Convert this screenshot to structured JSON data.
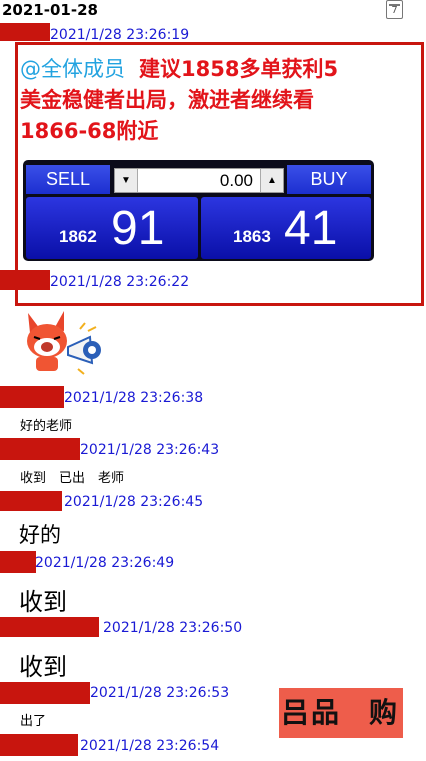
{
  "header": {
    "date": "2021-01-28",
    "calendar_day": "7"
  },
  "announcement": {
    "timestamp": "2021/1/28 23:26:19",
    "mention": "@全体成员",
    "line1": "建议1858多单获利5",
    "line2": "美金稳健者出局，激进者继续看",
    "line3": "1866-68附近"
  },
  "trade_widget": {
    "sell_label": "SELL",
    "buy_label": "BUY",
    "quantity": "0.00",
    "bid_base": "1862",
    "bid_pips": "91",
    "ask_base": "1863",
    "ask_pips": "41"
  },
  "messages": [
    {
      "timestamp": "2021/1/28 23:26:22",
      "text": ""
    },
    {
      "timestamp": "2021/1/28 23:26:38",
      "text": "好的老师"
    },
    {
      "timestamp": "2021/1/28 23:26:43",
      "text": "收到　已出　老师"
    },
    {
      "timestamp": "2021/1/28 23:26:45",
      "text": "好的"
    },
    {
      "timestamp": "2021/1/28 23:26:49",
      "text": "收到"
    },
    {
      "timestamp": "2021/1/28 23:26:50",
      "text": "收到"
    },
    {
      "timestamp": "2021/1/28 23:26:53",
      "text": "出了"
    },
    {
      "timestamp": "2021/1/28 23:26:54",
      "text": ""
    }
  ],
  "watermark": {
    "left": "吕品",
    "right": "购"
  },
  "colors": {
    "redact": "#c8150e",
    "timestamp": "#1a1ad4",
    "announce": "#e2141a",
    "mention": "#23a3e0"
  }
}
